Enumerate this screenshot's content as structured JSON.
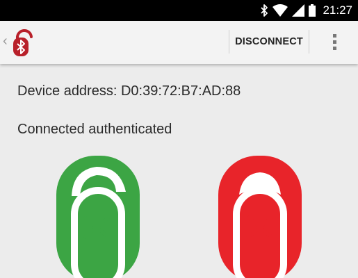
{
  "status_bar": {
    "time": "21:27",
    "icons": [
      "bluetooth-icon",
      "wifi-icon",
      "signal-icon",
      "battery-icon"
    ]
  },
  "app_bar": {
    "back_icon": "chevron-left-icon",
    "logo_icon": "bluetooth-lock-icon",
    "disconnect_label": "DISCONNECT",
    "overflow_icon": "more-vert-icon"
  },
  "main": {
    "device_address": "Device address: D0:39:72:B7:AD:88",
    "connection_status": "Connected authenticated",
    "locks": [
      {
        "state": "unlocked",
        "color": "#3ca544",
        "icon": "bluetooth-unlock-icon"
      },
      {
        "state": "locked",
        "color": "#e8242a",
        "icon": "bluetooth-lock-icon"
      }
    ]
  },
  "colors": {
    "appbar_background": "#f3f3f3",
    "page_background": "#ececec",
    "logo_red": "#b8202a"
  }
}
